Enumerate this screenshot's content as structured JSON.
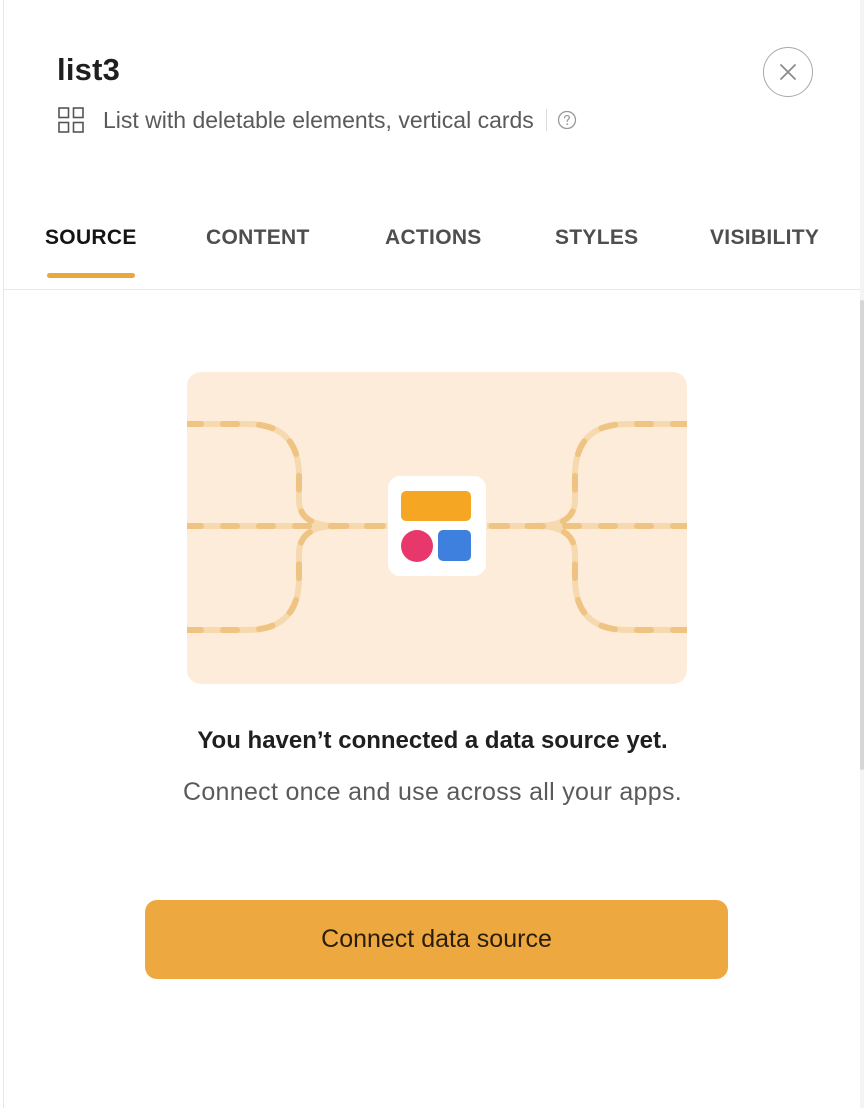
{
  "header": {
    "title": "list3",
    "subtitle": "List with deletable elements, vertical cards",
    "subtitle_icon": "grid-icon",
    "help_icon": "question-circle-icon",
    "close_icon": "close-icon"
  },
  "tabs": [
    {
      "label": "SOURCE",
      "active": true
    },
    {
      "label": "CONTENT",
      "active": false
    },
    {
      "label": "ACTIONS",
      "active": false
    },
    {
      "label": "STYLES",
      "active": false
    },
    {
      "label": "VISIBILITY",
      "active": false
    }
  ],
  "empty_state": {
    "title": "You haven’t connected a data source yet.",
    "subtitle": "Connect once and use across all your apps.",
    "illustration_icon": "data-source-app-icon",
    "colors": {
      "illustration_bg": "#fdecd9",
      "path": "#f6d9ae",
      "dash": "#efc483",
      "app_bar": "#f5a623",
      "app_circle": "#e8386b",
      "app_square": "#3d80dd"
    }
  },
  "actions": {
    "connect_label": "Connect data source"
  },
  "colors": {
    "accent": "#eba83a",
    "button": "#eda840"
  }
}
